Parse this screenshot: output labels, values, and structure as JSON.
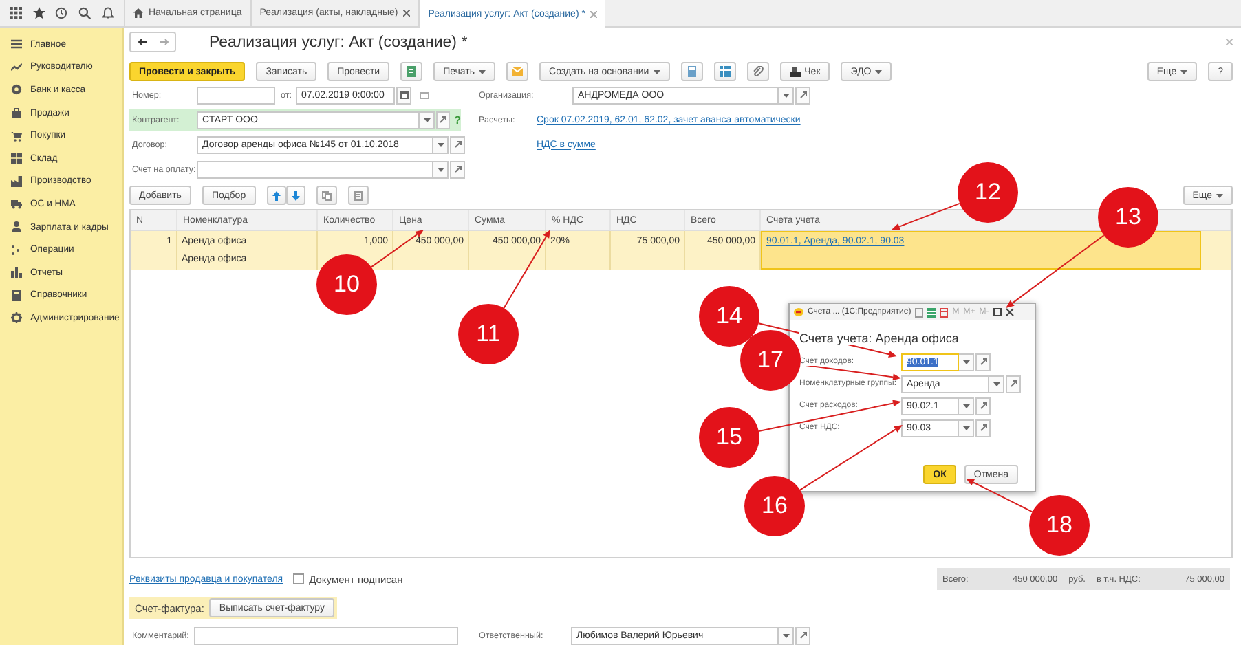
{
  "tabs": [
    {
      "label": "Начальная страница",
      "kind": "home",
      "selected": false
    },
    {
      "label": "Реализация (акты, накладные)",
      "kind": "closable",
      "selected": false
    },
    {
      "label": "Реализация услуг: Акт (создание) *",
      "kind": "closable",
      "selected": true
    }
  ],
  "sidebar": {
    "items": [
      {
        "label": "Главное"
      },
      {
        "label": "Руководителю"
      },
      {
        "label": "Банк и касса"
      },
      {
        "label": "Продажи"
      },
      {
        "label": "Покупки"
      },
      {
        "label": "Склад"
      },
      {
        "label": "Производство"
      },
      {
        "label": "ОС и НМА"
      },
      {
        "label": "Зарплата и кадры"
      },
      {
        "label": "Операции"
      },
      {
        "label": "Отчеты"
      },
      {
        "label": "Справочники"
      },
      {
        "label": "Администрирование"
      }
    ]
  },
  "document": {
    "title": "Реализация услуг: Акт (создание) *",
    "actions": [
      {
        "kind": "primary",
        "label": "Провести и закрыть"
      },
      {
        "kind": "button",
        "label": "Записать"
      },
      {
        "kind": "button",
        "label": "Провести"
      },
      {
        "kind": "icon"
      },
      {
        "kind": "menu",
        "label": "Печать"
      },
      {
        "kind": "icon"
      },
      {
        "kind": "menu",
        "label": "Создать на основании"
      },
      {
        "kind": "icon"
      },
      {
        "kind": "icon"
      },
      {
        "kind": "icon"
      },
      {
        "kind": "button",
        "label": "Чек"
      },
      {
        "kind": "menu",
        "label": "ЭДО"
      }
    ],
    "more": "Еще",
    "help": "?",
    "number": {
      "label": "Номер:"
    },
    "date": {
      "label": "от:",
      "value": "07.02.2019  0:00:00"
    },
    "organization": {
      "label": "Организация:",
      "value": "АНДРОМЕДА ООО"
    },
    "counterparty": {
      "label": "Контрагент:",
      "value": "СТАРТ ООО",
      "highlighted": true,
      "help": "?"
    },
    "settlements": {
      "label": "Расчеты:",
      "link": "Срок 07.02.2019, 62.01, 62.02, зачет аванса автоматически"
    },
    "contract": {
      "label": "Договор:",
      "value": "Договор аренды офиса №145 от 01.10.2018"
    },
    "vat_link": "НДС в сумме",
    "invoice_for_payment": {
      "label": "Счет на оплату:"
    }
  },
  "table": {
    "actions": [
      {
        "kind": "button",
        "label": "Добавить"
      },
      {
        "kind": "button",
        "label": "Подбор"
      },
      {
        "kind": "up"
      },
      {
        "kind": "down"
      },
      {
        "kind": "copy"
      },
      {
        "kind": "paste"
      }
    ],
    "more": "Еще",
    "columns": [
      "N",
      "Номенклатура",
      "Количество",
      "Цена",
      "Сумма",
      "% НДС",
      "НДС",
      "Всего",
      "Счета учета"
    ],
    "rows": [
      {
        "selected": true,
        "subline": "Аренда офиса",
        "cells": [
          {
            "text": "1",
            "focused": false
          },
          {
            "text": "Аренда офиса",
            "focused": false
          },
          {
            "text": "1,000",
            "focused": false
          },
          {
            "text": "450 000,00",
            "focused": false
          },
          {
            "text": "450 000,00",
            "focused": false
          },
          {
            "text": "20%",
            "focused": false
          },
          {
            "text": "75 000,00",
            "focused": false
          },
          {
            "text": "450 000,00",
            "focused": false
          },
          {
            "text": "90.01.1, Аренда, 90.02.1, 90.03",
            "focused": true
          }
        ]
      }
    ]
  },
  "footer": {
    "requisites_link": "Реквизиты продавца и покупателя",
    "signed": {
      "label": "Документ подписан",
      "checked": false
    },
    "totals": {
      "total_label": "Всего:",
      "total": "450 000,00",
      "currency": "руб.",
      "vat_label": "в т.ч. НДС:",
      "vat": "75 000,00"
    },
    "invoice": {
      "label": "Счет-фактура:",
      "button": "Выписать счет-фактуру"
    },
    "comment": {
      "label": "Комментарий:"
    },
    "responsible": {
      "label": "Ответственный:",
      "value": "Любимов Валерий Юрьевич"
    }
  },
  "dialog": {
    "window_title": "Счета ... (1С:Предприятие)",
    "memory_buttons": [
      "M",
      "M+",
      "M-"
    ],
    "heading": "Счета учета: Аренда офиса",
    "fields": [
      {
        "kind": "account",
        "label": "Счет доходов:",
        "value": "90.01.1",
        "selected": true
      },
      {
        "kind": "group",
        "label": "Номенклатурные группы:",
        "value": "Аренда",
        "selected": false
      },
      {
        "kind": "account",
        "label": "Счет расходов:",
        "value": "90.02.1",
        "selected": false
      },
      {
        "kind": "account",
        "label": "Счет НДС:",
        "value": "90.03",
        "selected": false
      }
    ],
    "buttons": [
      {
        "kind": "primary",
        "label": "ОК"
      },
      {
        "kind": "button",
        "label": "Отмена"
      }
    ]
  },
  "callouts": [
    {
      "number": "10"
    },
    {
      "number": "11"
    },
    {
      "number": "12"
    },
    {
      "number": "13"
    },
    {
      "number": "14"
    },
    {
      "number": "15"
    },
    {
      "number": "16"
    },
    {
      "number": "17"
    },
    {
      "number": "18"
    }
  ]
}
